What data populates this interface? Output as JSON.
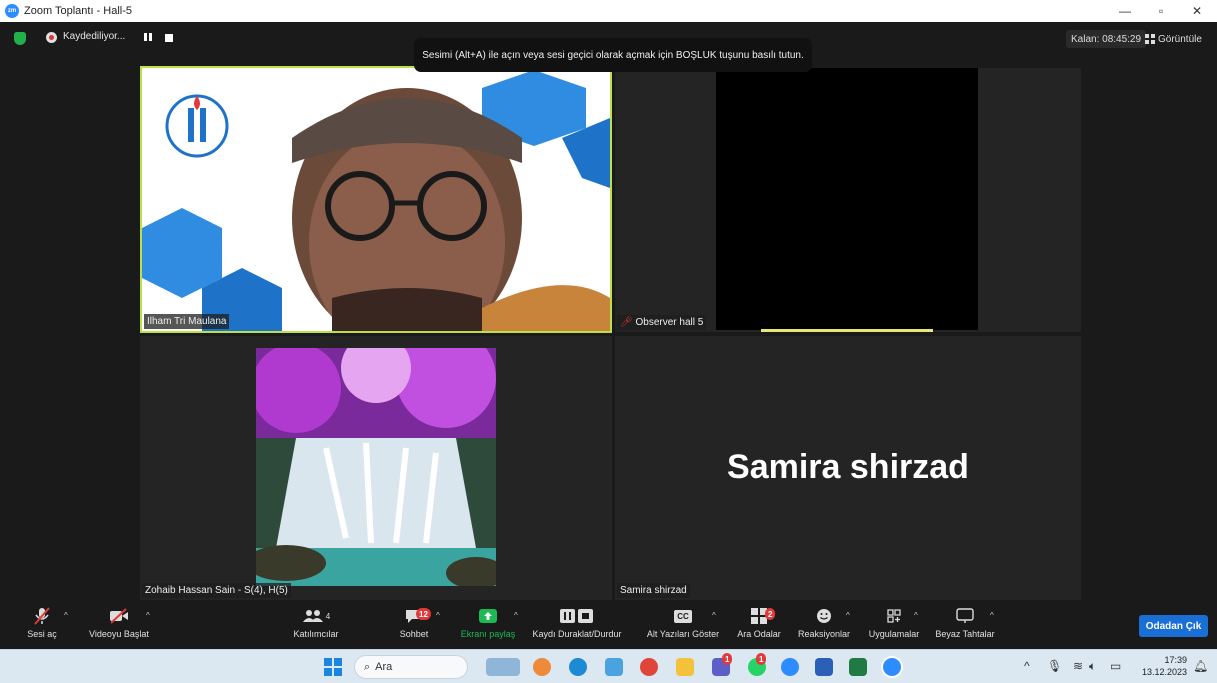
{
  "window": {
    "title": "Zoom Toplantı - Hall-5"
  },
  "topbar": {
    "recording_label": "Kaydediliyor...",
    "timer": "Kalan: 08:45:29",
    "view_label": "Görüntüle"
  },
  "tooltip": "Sesimi (Alt+A) ile açın veya sesi geçici olarak açmak için BOŞLUK tuşunu basılı tutun.",
  "participants": {
    "tile1": "Ilham Tri Maulana",
    "tile2": "Observer hall 5",
    "tile3": "Zohaib Hassan Sain - S(4), H(5)",
    "tile4_name": "Samira shirzad",
    "tile4_big": "Samira shirzad"
  },
  "toolbar": {
    "mute": "Sesi aç",
    "video": "Videoyu Başlat",
    "participants": "Katılımcılar",
    "participants_count": "4",
    "chat": "Sohbet",
    "chat_badge": "12",
    "share": "Ekranı paylaş",
    "record": "Kaydı Duraklat/Durdur",
    "captions": "Alt Yazıları Göster",
    "breakout": "Ara Odalar",
    "breakout_badge": "2",
    "reactions": "Reaksiyonlar",
    "apps": "Uygulamalar",
    "whiteboards": "Beyaz Tahtalar",
    "leave": "Odadan Çık",
    "cc_text": "CC"
  },
  "taskbar": {
    "search_placeholder": "Ara",
    "time": "17:39",
    "date": "13.12.2023",
    "teams_badge": "1",
    "whatsapp_badge": "1"
  },
  "colors": {
    "accent": "#2d8cff",
    "active_speaker": "#bde04a",
    "leave": "#1a6fd6",
    "share": "#1db954"
  }
}
